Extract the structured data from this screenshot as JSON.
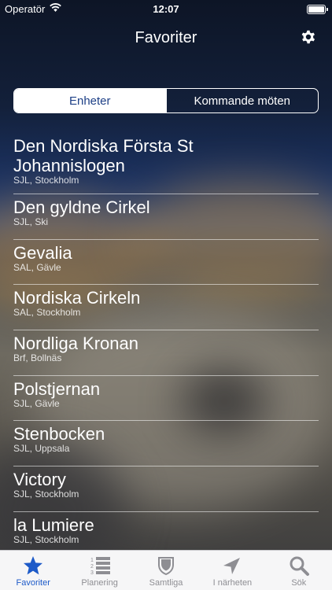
{
  "status_bar": {
    "carrier": "Operatör",
    "time": "12:07"
  },
  "navbar": {
    "title": "Favoriter",
    "settings_icon": "gear-icon"
  },
  "segments": [
    {
      "label": "Enheter",
      "selected": true
    },
    {
      "label": "Kommande möten",
      "selected": false
    }
  ],
  "units": [
    {
      "name": "Den Nordiska Första St Johannislogen",
      "sub": "SJL, Stockholm"
    },
    {
      "name": "Den gyldne Cirkel",
      "sub": "SJL, Ski"
    },
    {
      "name": "Gevalia",
      "sub": "SAL, Gävle"
    },
    {
      "name": "Nordiska Cirkeln",
      "sub": "SAL, Stockholm"
    },
    {
      "name": "Nordliga Kronan",
      "sub": "Brf, Bollnäs"
    },
    {
      "name": "Polstjernan",
      "sub": "SJL, Gävle"
    },
    {
      "name": "Stenbocken",
      "sub": "SJL, Uppsala"
    },
    {
      "name": "Victory",
      "sub": "SJL, Stockholm"
    },
    {
      "name": "la Lumiere",
      "sub": "SJL, Stockholm"
    }
  ],
  "tabs": [
    {
      "label": "Favoriter",
      "icon": "star-icon",
      "active": true
    },
    {
      "label": "Planering",
      "icon": "numbered-list-icon",
      "active": false
    },
    {
      "label": "Samtliga",
      "icon": "shield-icon",
      "active": false
    },
    {
      "label": "I närheten",
      "icon": "location-arrow-icon",
      "active": false
    },
    {
      "label": "Sök",
      "icon": "search-icon",
      "active": false
    }
  ],
  "colors": {
    "accent": "#1d5ac8",
    "segment_text": "#1d3f86",
    "tab_inactive": "#8e8e93"
  }
}
